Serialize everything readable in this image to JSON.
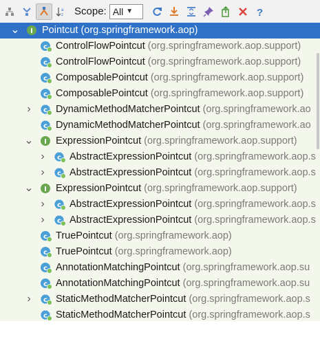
{
  "toolbar": {
    "buttons": [
      {
        "name": "supertypes-hierarchy-button",
        "icon": "supertypes-icon"
      },
      {
        "name": "subtypes-hierarchy-button",
        "icon": "subtypes-icon"
      },
      {
        "name": "class-hierarchy-button",
        "icon": "class-hierarchy-icon",
        "pressed": true
      },
      {
        "name": "sort-alphabetically-button",
        "icon": "sort-az-icon"
      }
    ],
    "scope_label": "Scope:",
    "scope_value": "All",
    "right_buttons": [
      {
        "name": "refresh-button",
        "icon": "refresh-icon"
      },
      {
        "name": "export-button",
        "icon": "export-icon"
      },
      {
        "name": "expand-all-button",
        "icon": "expand-all-icon"
      },
      {
        "name": "pin-button",
        "icon": "pin-icon"
      },
      {
        "name": "open-tab-button",
        "icon": "open-tab-icon"
      },
      {
        "name": "close-button",
        "icon": "close-icon"
      },
      {
        "name": "help-button",
        "icon": "help-icon"
      }
    ]
  },
  "tree": {
    "rows": [
      {
        "name": "Pointcut",
        "pkg": "(org.springframework.aop)",
        "kind": "interface",
        "level": 0,
        "expander": "expanded",
        "selected": true
      },
      {
        "name": "ControlFlowPointcut",
        "pkg": "(org.springframework.aop.support)",
        "kind": "class",
        "level": 1,
        "expander": "none"
      },
      {
        "name": "ControlFlowPointcut",
        "pkg": "(org.springframework.aop.support)",
        "kind": "class",
        "level": 1,
        "expander": "none"
      },
      {
        "name": "ComposablePointcut",
        "pkg": "(org.springframework.aop.support)",
        "kind": "class",
        "level": 1,
        "expander": "none"
      },
      {
        "name": "ComposablePointcut",
        "pkg": "(org.springframework.aop.support)",
        "kind": "class",
        "level": 1,
        "expander": "none"
      },
      {
        "name": "DynamicMethodMatcherPointcut",
        "pkg": "(org.springframework.ao",
        "kind": "abstract",
        "level": 1,
        "expander": "collapsed"
      },
      {
        "name": "DynamicMethodMatcherPointcut",
        "pkg": "(org.springframework.ao",
        "kind": "abstract",
        "level": 1,
        "expander": "none"
      },
      {
        "name": "ExpressionPointcut",
        "pkg": "(org.springframework.aop.support)",
        "kind": "interface",
        "level": 1,
        "expander": "expanded"
      },
      {
        "name": "AbstractExpressionPointcut",
        "pkg": "(org.springframework.aop.s",
        "kind": "abstract",
        "level": 2,
        "expander": "collapsed"
      },
      {
        "name": "AbstractExpressionPointcut",
        "pkg": "(org.springframework.aop.s",
        "kind": "abstract",
        "level": 2,
        "expander": "collapsed"
      },
      {
        "name": "ExpressionPointcut",
        "pkg": "(org.springframework.aop.support)",
        "kind": "interface",
        "level": 1,
        "expander": "expanded"
      },
      {
        "name": "AbstractExpressionPointcut",
        "pkg": "(org.springframework.aop.s",
        "kind": "abstract",
        "level": 2,
        "expander": "collapsed"
      },
      {
        "name": "AbstractExpressionPointcut",
        "pkg": "(org.springframework.aop.s",
        "kind": "abstract",
        "level": 2,
        "expander": "collapsed"
      },
      {
        "name": "TruePointcut",
        "pkg": "(org.springframework.aop)",
        "kind": "class",
        "level": 1,
        "expander": "none"
      },
      {
        "name": "TruePointcut",
        "pkg": "(org.springframework.aop)",
        "kind": "class",
        "level": 1,
        "expander": "none"
      },
      {
        "name": "AnnotationMatchingPointcut",
        "pkg": "(org.springframework.aop.su",
        "kind": "class",
        "level": 1,
        "expander": "none"
      },
      {
        "name": "AnnotationMatchingPointcut",
        "pkg": "(org.springframework.aop.su",
        "kind": "class",
        "level": 1,
        "expander": "none"
      },
      {
        "name": "StaticMethodMatcherPointcut",
        "pkg": "(org.springframework.aop.s",
        "kind": "abstract",
        "level": 1,
        "expander": "collapsed"
      },
      {
        "name": "StaticMethodMatcherPointcut",
        "pkg": "(org.springframework.aop.s",
        "kind": "abstract",
        "level": 1,
        "expander": "none"
      }
    ]
  },
  "colors": {
    "tree_background": "#f4f7ec",
    "selection": "#2f71c6",
    "class_icon": "#4a9fd6",
    "interface_icon": "#6aa84f",
    "package_text": "#7a7a7a"
  }
}
